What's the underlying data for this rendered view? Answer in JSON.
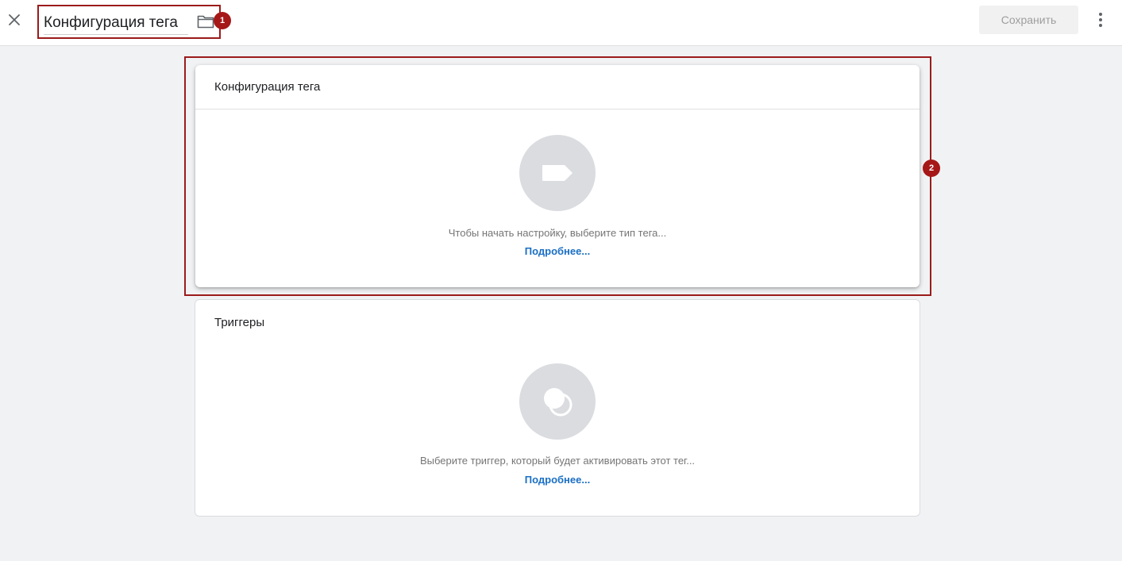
{
  "topbar": {
    "title_value": "Конфигурация тега",
    "save_label": "Сохранить",
    "badge_1": "1",
    "badge_2": "2"
  },
  "config_card": {
    "title": "Конфигурация тега",
    "hint": "Чтобы начать настройку, выберите тип тега...",
    "more": "Подробнее..."
  },
  "triggers_card": {
    "title": "Триггеры",
    "hint": "Выберите триггер, который будет активировать этот тег...",
    "more": "Подробнее..."
  },
  "colors": {
    "accent_red": "#a61717",
    "link_blue": "#1a6fc4",
    "icon_circle": "#dadce0"
  }
}
